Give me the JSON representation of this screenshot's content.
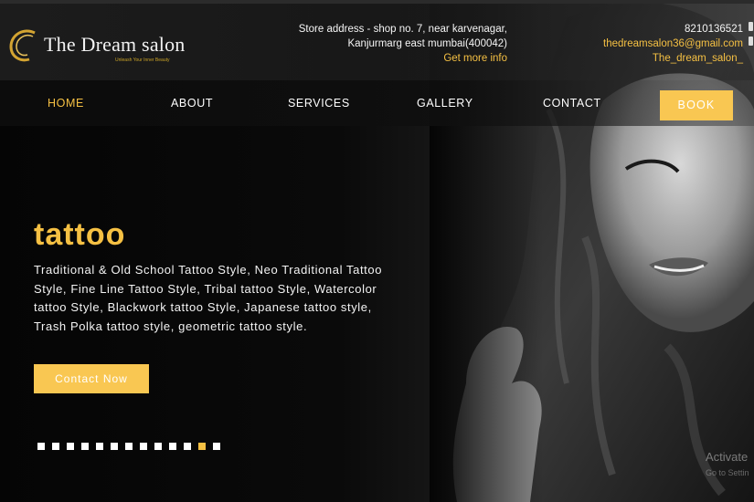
{
  "brand": {
    "name": "The Dream salon",
    "tagline": "Unleash Your Inner Beauty"
  },
  "header": {
    "address_line1": "Store address - shop no. 7, near karvenagar,",
    "address_line2": "Kanjurmarg east mumbai(400042)",
    "more_info": "Get more info",
    "phone": "8210136521",
    "email": "thedreamsalon36@gmail.com",
    "instagram": "The_dream_salon_"
  },
  "nav": {
    "items": [
      "HOME",
      "ABOUT",
      "SERVICES",
      "GALLERY",
      "CONTACT"
    ],
    "active": "HOME",
    "book_label": "BOOK"
  },
  "hero": {
    "title": "tattoo",
    "description": "Traditional & Old School Tattoo Style, Neo Traditional Tattoo Style, Fine Line Tattoo Style, Tribal tattoo Style, Watercolor tattoo Style, Blackwork tattoo Style, Japanese tattoo style, Trash Polka tattoo style, geometric tattoo style.",
    "cta_label": "Contact Now"
  },
  "slider": {
    "total": 13,
    "active_index": 11
  },
  "watermark": {
    "title": "Activate",
    "subtitle": "Go to Settin"
  },
  "colors": {
    "accent": "#f5c043",
    "button": "#f9c752",
    "background": "#050505"
  }
}
